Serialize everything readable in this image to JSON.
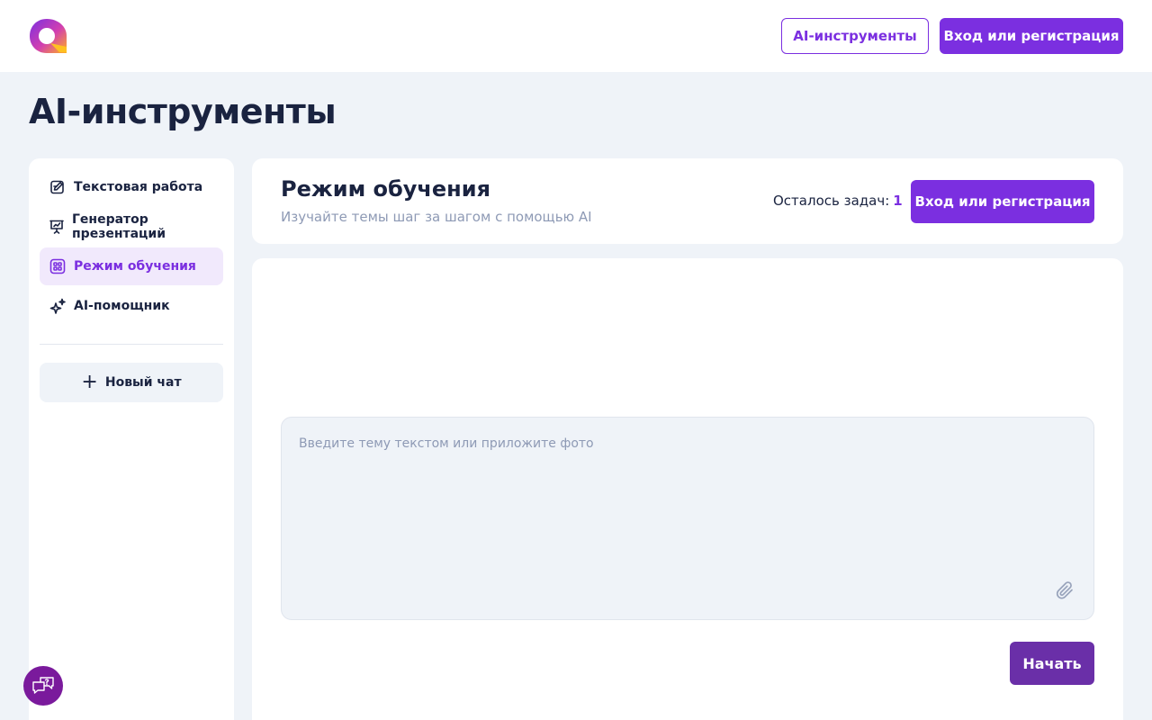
{
  "header": {
    "ai_tools_label": "AI-инструменты",
    "login_label": "Вход или регистрация"
  },
  "page": {
    "title": "AI-инструменты"
  },
  "sidebar": {
    "items": [
      {
        "label": "Текстовая работа",
        "icon": "edit-document-icon",
        "active": false
      },
      {
        "label": "Генератор презентаций",
        "icon": "presentation-icon",
        "active": false
      },
      {
        "label": "Режим обучения",
        "icon": "grid-learning-icon",
        "active": true
      },
      {
        "label": "AI-помощник",
        "icon": "sparkle-icon",
        "active": false
      }
    ],
    "new_chat_label": "Новый чат"
  },
  "mode": {
    "title": "Режим обучения",
    "subtitle": "Изучайте темы шаг за шагом с помощью AI",
    "tasks_label": "Осталось задач:",
    "tasks_count": "1",
    "login_label": "Вход или регистрация"
  },
  "topic": {
    "placeholder": "Введите тему текстом или приложите фото",
    "value": ""
  },
  "actions": {
    "start_label": "Начать"
  },
  "colors": {
    "accent": "#7b2fe0",
    "start_button": "#6a2fa8",
    "help_button": "#7a1a9c",
    "background": "#eff3f8"
  }
}
